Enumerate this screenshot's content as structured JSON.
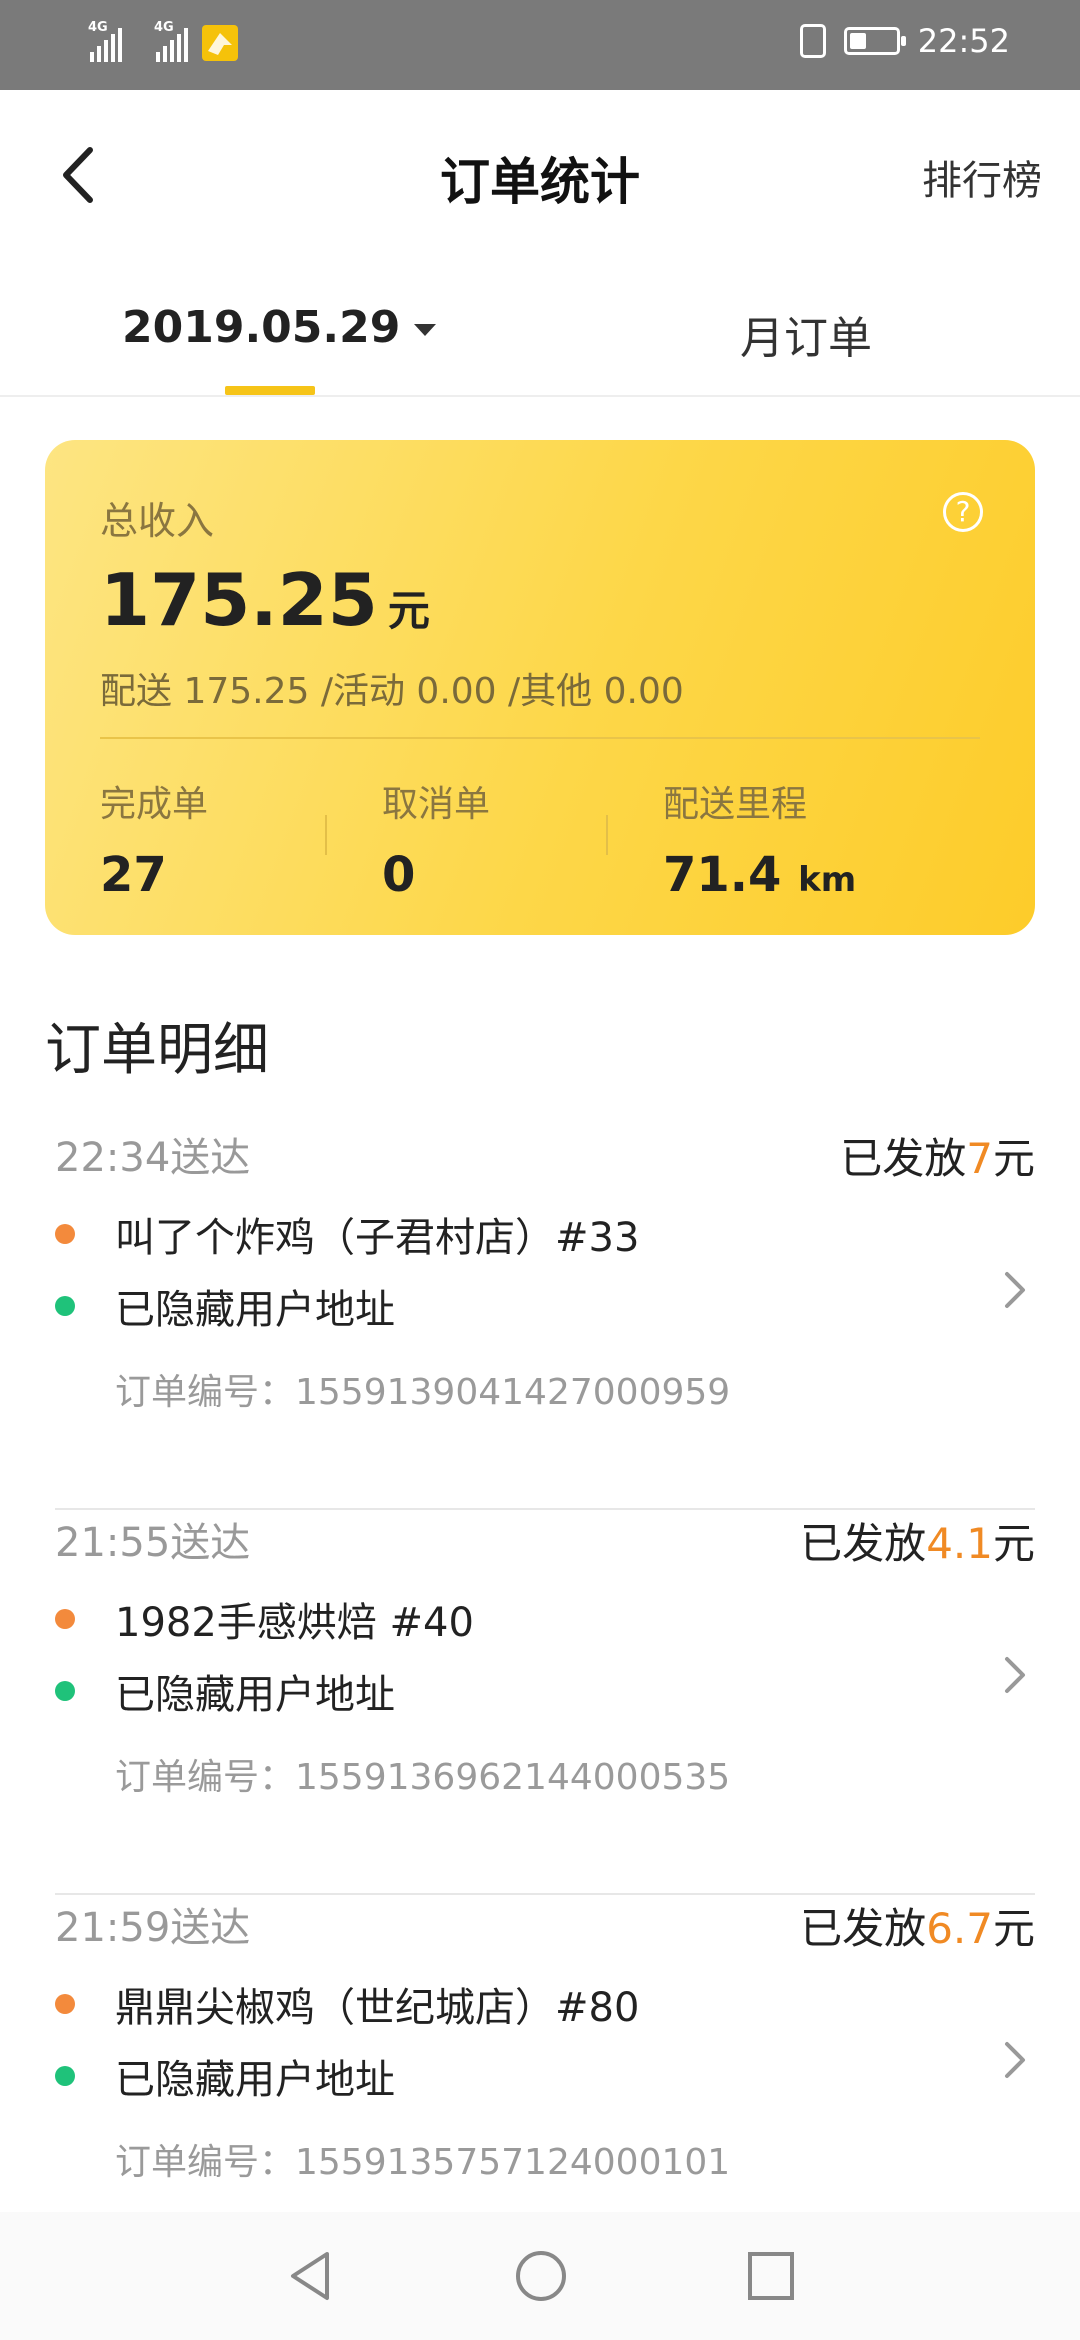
{
  "status_bar": {
    "signal_1": "4G",
    "signal_2": "4G",
    "time": "22:52",
    "icons": [
      "signal-icon",
      "signal-icon",
      "app-notification-icon",
      "vibrate-icon",
      "battery-icon"
    ]
  },
  "header": {
    "title": "订单统计",
    "right_link": "排行榜"
  },
  "tabs": {
    "date": "2019.05.29",
    "month": "月订单"
  },
  "income": {
    "label": "总收入",
    "amount": "175.25",
    "unit": "元",
    "breakdown": "配送 175.25  /活动 0.00  /其他 0.00",
    "stats": [
      {
        "label": "完成单",
        "value": "27",
        "unit": ""
      },
      {
        "label": "取消单",
        "value": "0",
        "unit": ""
      },
      {
        "label": "配送里程",
        "value": "71.4",
        "unit": "km"
      }
    ],
    "help_glyph": "?"
  },
  "section": {
    "title": "订单明细"
  },
  "orders": [
    {
      "time": "22:34送达",
      "paid_prefix": "已发放",
      "paid_amount": "7",
      "paid_unit": "元",
      "shop": "叫了个炸鸡（子君村店）#33",
      "address": "已隐藏用户地址",
      "order_no": "订单编号：1559139041427000959"
    },
    {
      "time": "21:55送达",
      "paid_prefix": "已发放",
      "paid_amount": "4.1",
      "paid_unit": "元",
      "shop": "1982手感烘焙 #40",
      "address": "已隐藏用户地址",
      "order_no": "订单编号：1559136962144000535"
    },
    {
      "time": "21:59送达",
      "paid_prefix": "已发放",
      "paid_amount": "6.7",
      "paid_unit": "元",
      "shop": "鼎鼎尖椒鸡（世纪城店）#80",
      "address": "已隐藏用户地址",
      "order_no": "订单编号：1559135757124000101"
    }
  ],
  "colors": {
    "accent_yellow": "#f6c418",
    "amount_orange": "#f08a24",
    "dot_orange": "#f38a3c",
    "dot_green": "#1fc27a"
  }
}
